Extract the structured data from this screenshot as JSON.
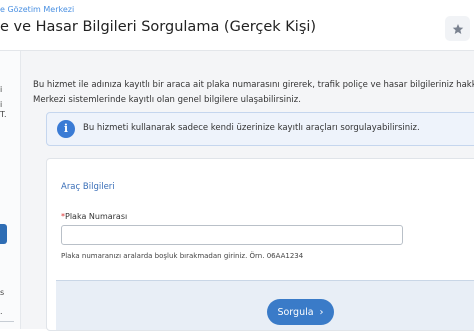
{
  "header": {
    "breadcrumb": "e Gözetim Merkezi",
    "title": "e ve Hasar Bilgileri Sorgulama (Gerçek Kişi)",
    "favorite_icon": "star-icon"
  },
  "sidebar": {
    "fragments": [
      "i",
      "i",
      "T.",
      "s",
      "."
    ]
  },
  "intro": {
    "line1": "Bu hizmet ile adınıza kayıtlı bir araca ait plaka numarasını girerek, trafik poliçe ve hasar bilgileriniz hakkında Sigorta",
    "line2": "Merkezi sistemlerinde kayıtlı olan genel bilgilere ulaşabilirsiniz."
  },
  "info": {
    "icon": "info-icon",
    "text": "Bu hizmeti kullanarak sadece kendi üzerinize kayıtlı araçları sorgulayabilirsiniz."
  },
  "form": {
    "section_title": "Araç Bilgileri",
    "required_mark": "*",
    "plate_label": "Plaka Numarası",
    "plate_value": "",
    "plate_hint": "Plaka numaranızı aralarda boşluk bırakmadan giriniz. Örn. 06AA1234",
    "submit_label": "Sorgula",
    "submit_icon": "chevron-right-icon"
  },
  "colors": {
    "accent": "#3a7bc8",
    "info_bg": "#eef3fb",
    "link": "#4a90e2"
  }
}
